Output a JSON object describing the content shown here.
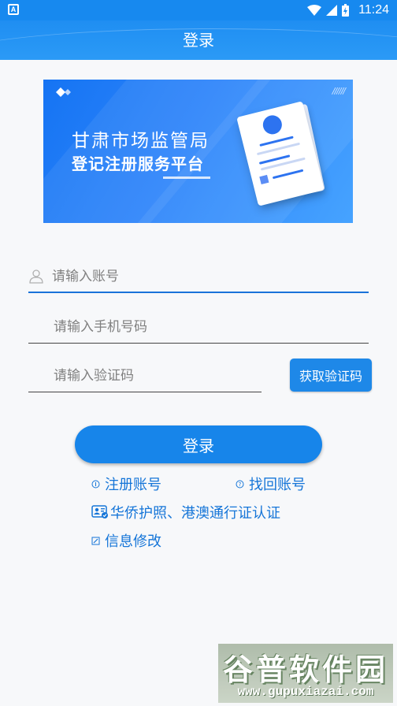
{
  "status_bar": {
    "time": "11:24",
    "notification_icon": "A"
  },
  "header": {
    "title": "登录"
  },
  "banner": {
    "title": "甘肃市场监管局",
    "subtitle": "登记注册服务平台",
    "decor_slashes": "//////"
  },
  "form": {
    "account_placeholder": "请输入账号",
    "phone_placeholder": "请输入手机号码",
    "code_placeholder": "请输入验证码",
    "get_code_label": "获取验证码",
    "login_label": "登录"
  },
  "links": {
    "register": "注册账号",
    "recover": "找回账号",
    "passport": "华侨护照、港澳通行证认证",
    "info_edit": "信息修改"
  },
  "watermark": {
    "title": "谷普软件园",
    "url": "www.gupuxiazai.com"
  },
  "colors": {
    "primary": "#1785ea",
    "link": "#1575d8",
    "header": "#1f8ef2"
  }
}
